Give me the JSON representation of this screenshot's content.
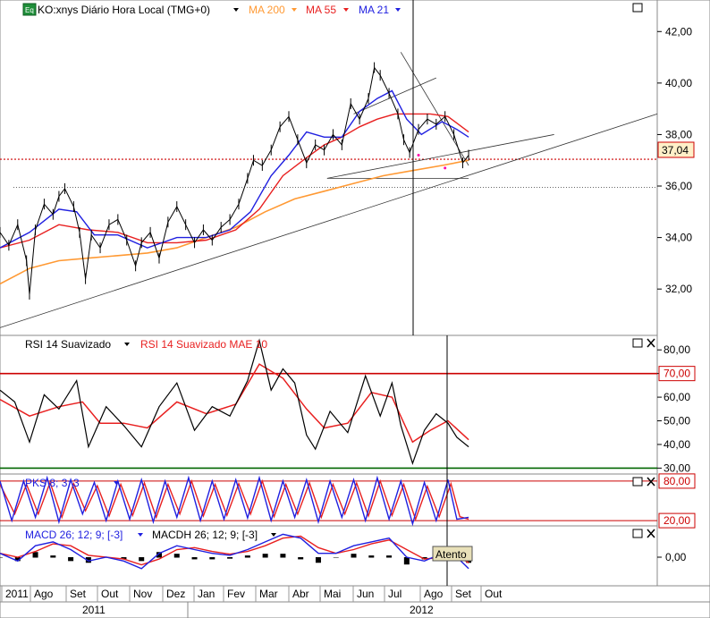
{
  "colors": {
    "price": "#000000",
    "ma200": "#ff9933",
    "ma55": "#e82020",
    "ma21": "#2020e0",
    "rsi_line": "#000000",
    "rsi_signal": "#e82020",
    "stoch_k": "#2020e0",
    "stoch_d": "#e82020",
    "macd_line": "#2020e0",
    "macd_signal": "#e82020",
    "macd_hist": "#000000",
    "ref_red": "#cc0000",
    "ref_green": "#006600",
    "price_box_bg": "#fff0c8"
  },
  "icons": {
    "maximize": "square-icon",
    "close": "x-icon",
    "dropdown": "triangle-down-icon",
    "equity": "eq-badge-icon"
  },
  "chart_data": [
    {
      "id": "price",
      "type": "line",
      "title": "KO:xnys Diário Hora Local (TMG+0)",
      "legend": [
        "MA 200",
        "MA 55",
        "MA 21"
      ],
      "ylim": [
        30.2,
        42.6
      ],
      "yticks": [
        "42,00",
        "40,00",
        "38,00",
        "36,00",
        "34,00",
        "32,00"
      ],
      "ytick_values": [
        42,
        40,
        38,
        36,
        34,
        32
      ],
      "last_price_label": "37,04",
      "last_price": 37.04,
      "support_level": 35.95,
      "x_range": [
        0,
        22.3
      ],
      "price_points": [
        [
          0,
          34.2
        ],
        [
          0.3,
          33.7
        ],
        [
          0.6,
          34.5
        ],
        [
          0.9,
          33.1
        ],
        [
          1.0,
          31.8
        ],
        [
          1.2,
          34.3
        ],
        [
          1.5,
          35.3
        ],
        [
          1.8,
          34.9
        ],
        [
          2.0,
          35.6
        ],
        [
          2.2,
          35.9
        ],
        [
          2.5,
          35.2
        ],
        [
          2.7,
          34.2
        ],
        [
          2.9,
          32.4
        ],
        [
          3.1,
          34.1
        ],
        [
          3.4,
          33.6
        ],
        [
          3.7,
          34.5
        ],
        [
          4.0,
          34.7
        ],
        [
          4.3,
          33.9
        ],
        [
          4.6,
          32.9
        ],
        [
          4.8,
          33.8
        ],
        [
          5.1,
          34.2
        ],
        [
          5.4,
          33.2
        ],
        [
          5.7,
          34.6
        ],
        [
          6.0,
          35.2
        ],
        [
          6.3,
          34.5
        ],
        [
          6.6,
          33.8
        ],
        [
          6.9,
          34.3
        ],
        [
          7.2,
          33.9
        ],
        [
          7.5,
          34.4
        ],
        [
          7.8,
          34.7
        ],
        [
          8.1,
          35.3
        ],
        [
          8.4,
          36.3
        ],
        [
          8.6,
          37.0
        ],
        [
          8.9,
          36.8
        ],
        [
          9.2,
          37.4
        ],
        [
          9.5,
          38.3
        ],
        [
          9.8,
          38.7
        ],
        [
          10.1,
          37.8
        ],
        [
          10.4,
          36.9
        ],
        [
          10.7,
          37.6
        ],
        [
          11.0,
          37.4
        ],
        [
          11.3,
          38.0
        ],
        [
          11.6,
          37.6
        ],
        [
          11.9,
          39.2
        ],
        [
          12.2,
          38.6
        ],
        [
          12.5,
          39.4
        ],
        [
          12.7,
          40.6
        ],
        [
          12.9,
          40.3
        ],
        [
          13.2,
          39.6
        ],
        [
          13.5,
          38.8
        ],
        [
          13.7,
          37.8
        ],
        [
          13.9,
          37.3
        ],
        [
          14.2,
          38.2
        ],
        [
          14.5,
          38.6
        ],
        [
          14.8,
          38.4
        ],
        [
          15.1,
          38.7
        ],
        [
          15.4,
          38.0
        ],
        [
          15.7,
          36.9
        ],
        [
          15.9,
          37.2
        ]
      ],
      "ma21_points": [
        [
          0,
          33.6
        ],
        [
          1,
          34.2
        ],
        [
          2,
          35.1
        ],
        [
          2.6,
          35.0
        ],
        [
          3.2,
          34.1
        ],
        [
          4,
          34.1
        ],
        [
          5,
          33.6
        ],
        [
          6,
          34.0
        ],
        [
          7,
          34.0
        ],
        [
          7.8,
          34.3
        ],
        [
          8.5,
          35.0
        ],
        [
          9.2,
          36.4
        ],
        [
          9.8,
          37.2
        ],
        [
          10.4,
          38.1
        ],
        [
          11,
          37.9
        ],
        [
          11.6,
          37.9
        ],
        [
          12.2,
          38.9
        ],
        [
          12.8,
          39.4
        ],
        [
          13.3,
          39.7
        ],
        [
          13.8,
          38.6
        ],
        [
          14.3,
          38.0
        ],
        [
          15,
          38.5
        ],
        [
          15.5,
          38.2
        ],
        [
          15.9,
          37.9
        ]
      ],
      "ma55_points": [
        [
          0,
          33.6
        ],
        [
          1,
          33.9
        ],
        [
          2,
          34.5
        ],
        [
          3,
          34.3
        ],
        [
          4,
          34.2
        ],
        [
          5,
          33.8
        ],
        [
          6,
          33.8
        ],
        [
          7,
          33.9
        ],
        [
          8,
          34.3
        ],
        [
          8.8,
          35.1
        ],
        [
          9.6,
          36.4
        ],
        [
          10.4,
          37.1
        ],
        [
          11,
          37.6
        ],
        [
          11.6,
          37.9
        ],
        [
          12.2,
          38.3
        ],
        [
          12.8,
          38.6
        ],
        [
          13.4,
          38.8
        ],
        [
          14,
          38.8
        ],
        [
          14.6,
          38.8
        ],
        [
          15.2,
          38.7
        ],
        [
          15.9,
          38.1
        ]
      ],
      "ma200_points": [
        [
          0,
          32.2
        ],
        [
          1,
          32.8
        ],
        [
          2,
          33.1
        ],
        [
          3,
          33.2
        ],
        [
          4,
          33.3
        ],
        [
          5,
          33.4
        ],
        [
          6,
          33.6
        ],
        [
          7,
          34.0
        ],
        [
          8,
          34.4
        ],
        [
          9,
          35.0
        ],
        [
          10,
          35.5
        ],
        [
          11,
          35.8
        ],
        [
          12,
          36.1
        ],
        [
          13,
          36.4
        ],
        [
          14,
          36.6
        ],
        [
          15,
          36.8
        ],
        [
          15.9,
          37.0
        ]
      ],
      "trendlines": [
        [
          [
            0,
            30.5
          ],
          [
            22.3,
            38.8
          ]
        ],
        [
          [
            11.1,
            36.3
          ],
          [
            18.8,
            38.0
          ]
        ],
        [
          [
            12.0,
            38.8
          ],
          [
            14.8,
            40.2
          ]
        ],
        [
          [
            13.6,
            41.2
          ],
          [
            15.9,
            36.8
          ]
        ],
        [
          [
            11.1,
            36.3
          ],
          [
            15.9,
            36.3
          ]
        ]
      ],
      "dots": [
        [
          15.1,
          36.7
        ],
        [
          14.2,
          37.2
        ]
      ]
    },
    {
      "id": "rsi",
      "type": "line",
      "legend": [
        "RSI 14 Suavizado",
        "RSI 14 Suavizado MAE 10"
      ],
      "ylim": [
        27.5,
        85
      ],
      "yticks": [
        "80,00",
        "70,00",
        "60,00",
        "50,00",
        "40,00",
        "30,00"
      ],
      "ytick_values": [
        80,
        70,
        60,
        50,
        40,
        30
      ],
      "ref_lines": [
        70,
        30
      ],
      "ref_labels": [
        "70,00",
        "30,00"
      ],
      "rsi_points": [
        [
          0,
          63
        ],
        [
          0.5,
          58
        ],
        [
          1.0,
          41
        ],
        [
          1.5,
          61
        ],
        [
          2.0,
          55
        ],
        [
          2.6,
          67
        ],
        [
          3.0,
          39
        ],
        [
          3.6,
          56
        ],
        [
          4.2,
          48
        ],
        [
          4.8,
          39
        ],
        [
          5.4,
          56
        ],
        [
          6.0,
          66
        ],
        [
          6.6,
          46
        ],
        [
          7.2,
          56
        ],
        [
          7.8,
          52
        ],
        [
          8.4,
          67
        ],
        [
          8.8,
          84
        ],
        [
          9.2,
          63
        ],
        [
          9.6,
          72
        ],
        [
          10.0,
          66
        ],
        [
          10.4,
          44
        ],
        [
          10.7,
          38
        ],
        [
          11.2,
          54
        ],
        [
          11.8,
          45
        ],
        [
          12.4,
          69
        ],
        [
          12.9,
          52
        ],
        [
          13.3,
          66
        ],
        [
          13.6,
          48
        ],
        [
          14.0,
          32
        ],
        [
          14.4,
          46
        ],
        [
          14.8,
          53
        ],
        [
          15.2,
          49
        ],
        [
          15.5,
          43
        ],
        [
          15.9,
          39
        ]
      ],
      "mae_points": [
        [
          0,
          59
        ],
        [
          1.0,
          52
        ],
        [
          2.0,
          56
        ],
        [
          2.8,
          58
        ],
        [
          3.4,
          49
        ],
        [
          4.2,
          49
        ],
        [
          5.0,
          47
        ],
        [
          6.0,
          58
        ],
        [
          7.0,
          53
        ],
        [
          8.0,
          57
        ],
        [
          8.8,
          74
        ],
        [
          9.6,
          68
        ],
        [
          10.4,
          55
        ],
        [
          11.0,
          47
        ],
        [
          11.8,
          49
        ],
        [
          12.6,
          62
        ],
        [
          13.3,
          60
        ],
        [
          14.0,
          41
        ],
        [
          14.6,
          46
        ],
        [
          15.2,
          50
        ],
        [
          15.9,
          42
        ]
      ]
    },
    {
      "id": "stochastic",
      "type": "line",
      "legend": [
        "PKS 8; 3; 3"
      ],
      "ylim": [
        12,
        88
      ],
      "yticks": [
        "80,00",
        "20,00"
      ],
      "ytick_values": [
        80,
        20
      ],
      "ref_lines": [
        80,
        20
      ],
      "ref_labels": [
        "80,00",
        "20,00"
      ],
      "k_points": [
        [
          0,
          80
        ],
        [
          0.4,
          20
        ],
        [
          0.8,
          80
        ],
        [
          1.2,
          25
        ],
        [
          1.6,
          85
        ],
        [
          2.0,
          18
        ],
        [
          2.4,
          82
        ],
        [
          2.8,
          30
        ],
        [
          3.2,
          78
        ],
        [
          3.6,
          20
        ],
        [
          4.0,
          80
        ],
        [
          4.4,
          22
        ],
        [
          4.8,
          82
        ],
        [
          5.2,
          18
        ],
        [
          5.6,
          80
        ],
        [
          6.0,
          25
        ],
        [
          6.4,
          85
        ],
        [
          6.8,
          20
        ],
        [
          7.2,
          80
        ],
        [
          7.6,
          22
        ],
        [
          8.0,
          82
        ],
        [
          8.4,
          24
        ],
        [
          8.8,
          85
        ],
        [
          9.2,
          20
        ],
        [
          9.6,
          80
        ],
        [
          10.0,
          25
        ],
        [
          10.4,
          82
        ],
        [
          10.8,
          18
        ],
        [
          11.2,
          80
        ],
        [
          11.6,
          25
        ],
        [
          12.0,
          82
        ],
        [
          12.4,
          20
        ],
        [
          12.8,
          85
        ],
        [
          13.2,
          22
        ],
        [
          13.6,
          80
        ],
        [
          14.0,
          15
        ],
        [
          14.4,
          78
        ],
        [
          14.8,
          20
        ],
        [
          15.2,
          82
        ],
        [
          15.5,
          22
        ],
        [
          15.9,
          25
        ]
      ],
      "d_points": [
        [
          0,
          75
        ],
        [
          0.5,
          30
        ],
        [
          0.9,
          75
        ],
        [
          1.3,
          30
        ],
        [
          1.7,
          78
        ],
        [
          2.1,
          25
        ],
        [
          2.5,
          76
        ],
        [
          2.9,
          35
        ],
        [
          3.3,
          73
        ],
        [
          3.7,
          27
        ],
        [
          4.1,
          75
        ],
        [
          4.5,
          28
        ],
        [
          4.9,
          77
        ],
        [
          5.3,
          25
        ],
        [
          5.7,
          75
        ],
        [
          6.1,
          30
        ],
        [
          6.5,
          80
        ],
        [
          6.9,
          27
        ],
        [
          7.3,
          75
        ],
        [
          7.7,
          28
        ],
        [
          8.1,
          76
        ],
        [
          8.5,
          30
        ],
        [
          8.9,
          80
        ],
        [
          9.3,
          26
        ],
        [
          9.7,
          75
        ],
        [
          10.1,
          30
        ],
        [
          10.5,
          77
        ],
        [
          10.9,
          25
        ],
        [
          11.3,
          75
        ],
        [
          11.7,
          30
        ],
        [
          12.1,
          77
        ],
        [
          12.5,
          27
        ],
        [
          12.9,
          80
        ],
        [
          13.3,
          28
        ],
        [
          13.7,
          75
        ],
        [
          14.1,
          22
        ],
        [
          14.5,
          72
        ],
        [
          14.9,
          26
        ],
        [
          15.3,
          76
        ],
        [
          15.6,
          26
        ],
        [
          15.9,
          22
        ]
      ]
    },
    {
      "id": "macd",
      "type": "line",
      "legend": [
        "MACD 26; 12; 9; [-3]",
        "MACDH 26; 12; 9; [-3]"
      ],
      "ylim": [
        -0.75,
        0.75
      ],
      "yticks": [
        "0,00"
      ],
      "ytick_values": [
        0
      ],
      "annotation": "Atento",
      "macd_points": [
        [
          0,
          0.1
        ],
        [
          0.6,
          -0.1
        ],
        [
          1.2,
          0.3
        ],
        [
          1.8,
          0.4
        ],
        [
          2.4,
          0.2
        ],
        [
          3.0,
          -0.1
        ],
        [
          3.6,
          0.0
        ],
        [
          4.2,
          -0.1
        ],
        [
          4.8,
          -0.3
        ],
        [
          5.4,
          0.1
        ],
        [
          6.0,
          0.3
        ],
        [
          6.6,
          0.2
        ],
        [
          7.2,
          0.1
        ],
        [
          7.8,
          0.05
        ],
        [
          8.4,
          0.2
        ],
        [
          9.0,
          0.4
        ],
        [
          9.6,
          0.6
        ],
        [
          10.2,
          0.5
        ],
        [
          10.8,
          0.1
        ],
        [
          11.4,
          0.1
        ],
        [
          12.0,
          0.3
        ],
        [
          12.6,
          0.4
        ],
        [
          13.2,
          0.5
        ],
        [
          13.8,
          0.0
        ],
        [
          14.4,
          -0.1
        ],
        [
          15.0,
          0.1
        ],
        [
          15.5,
          0.0
        ],
        [
          15.9,
          -0.3
        ]
      ],
      "signal_points": [
        [
          0,
          0.1
        ],
        [
          0.6,
          0.0
        ],
        [
          1.2,
          0.15
        ],
        [
          1.8,
          0.35
        ],
        [
          2.4,
          0.3
        ],
        [
          3.0,
          0.05
        ],
        [
          3.6,
          0.0
        ],
        [
          4.2,
          -0.05
        ],
        [
          4.8,
          -0.2
        ],
        [
          5.4,
          -0.05
        ],
        [
          6.0,
          0.2
        ],
        [
          6.6,
          0.25
        ],
        [
          7.2,
          0.15
        ],
        [
          7.8,
          0.08
        ],
        [
          8.4,
          0.15
        ],
        [
          9.0,
          0.3
        ],
        [
          9.6,
          0.5
        ],
        [
          10.2,
          0.55
        ],
        [
          10.8,
          0.25
        ],
        [
          11.4,
          0.1
        ],
        [
          12.0,
          0.2
        ],
        [
          12.6,
          0.35
        ],
        [
          13.2,
          0.45
        ],
        [
          13.8,
          0.2
        ],
        [
          14.4,
          -0.05
        ],
        [
          15.0,
          0.0
        ],
        [
          15.5,
          0.05
        ],
        [
          15.9,
          -0.15
        ]
      ]
    }
  ],
  "time_axis": {
    "months": [
      "2011",
      "Ago",
      "Set",
      "Out",
      "Nov",
      "Dez",
      "Jan",
      "Fev",
      "Mar",
      "Abr",
      "Mai",
      "Jun",
      "Jul",
      "Ago",
      "Set",
      "Out"
    ],
    "years": [
      "2011",
      "2012"
    ]
  }
}
